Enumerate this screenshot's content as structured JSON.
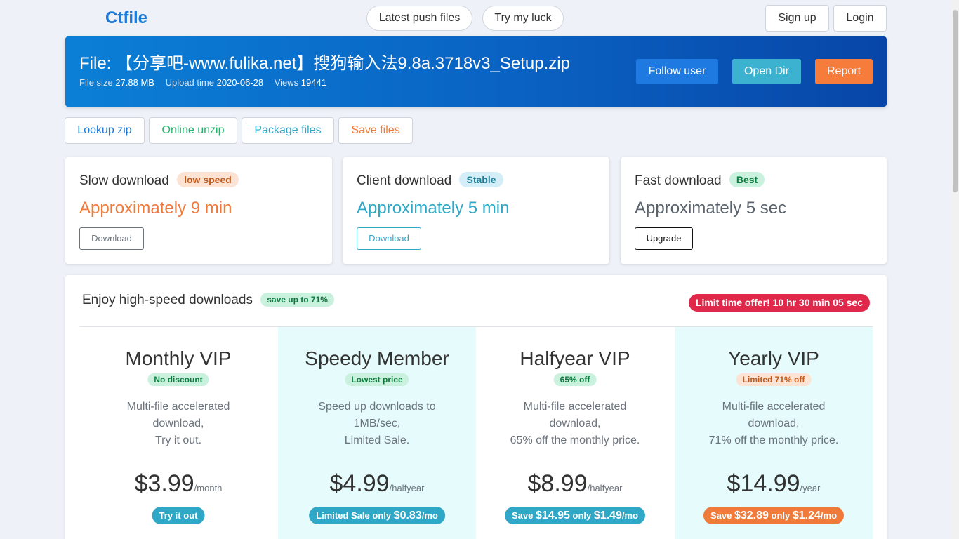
{
  "nav": {
    "brand": "Ctfile",
    "latest_push": "Latest push files",
    "try_luck": "Try my luck",
    "sign_up": "Sign up",
    "login": "Login"
  },
  "file": {
    "title": "File: 【分享吧-www.fulika.net】搜狗输入法9.8a.3718v3_Setup.zip",
    "size_label": "File size",
    "size": "27.88 MB",
    "upload_label": "Upload time",
    "upload": "2020-06-28",
    "views_label": "Views",
    "views": "19441",
    "follow": "Follow user",
    "open_dir": "Open Dir",
    "report": "Report"
  },
  "actions": {
    "lookup": "Lookup zip",
    "unzip": "Online unzip",
    "package": "Package files",
    "save": "Save files"
  },
  "downloads": {
    "slow": {
      "title": "Slow download",
      "badge": "low speed",
      "time": "Approximately 9 min",
      "button": "Download"
    },
    "client": {
      "title": "Client download",
      "badge": "Stable",
      "time": "Approximately 5 min",
      "button": "Download"
    },
    "fast": {
      "title": "Fast download",
      "badge": "Best",
      "time": "Approximately 5 sec",
      "button": "Upgrade"
    }
  },
  "pricing": {
    "title": "Enjoy high-speed downloads",
    "save_badge": "save up to 71%",
    "offer": "Limit time offer! 10 hr 30 min 05 sec",
    "plans": [
      {
        "name": "Monthly VIP",
        "tag": "No discount",
        "desc": [
          "Multi-file accelerated",
          "download,",
          "Try it out."
        ],
        "price": "$3.99",
        "period": "/month",
        "cta": {
          "prefix": "Try it out",
          "v1": "",
          "mid": "",
          "v2": "",
          "suffix": ""
        }
      },
      {
        "name": "Speedy Member",
        "tag": "Lowest price",
        "desc": [
          "Speed up downloads to",
          "1MB/sec,",
          "Limited Sale."
        ],
        "price": "$4.99",
        "period": "/halfyear",
        "cta": {
          "prefix": "Limited Sale only ",
          "v1": "$0.83",
          "mid": "",
          "v2": "",
          "suffix": "/mo"
        }
      },
      {
        "name": "Halfyear VIP",
        "tag": "65% off",
        "desc": [
          "Multi-file accelerated",
          "download,",
          "65% off the monthly price."
        ],
        "price": "$8.99",
        "period": "/halfyear",
        "cta": {
          "prefix": "Save ",
          "v1": "$14.95",
          "mid": " only ",
          "v2": "$1.49",
          "suffix": "/mo"
        }
      },
      {
        "name": "Yearly VIP",
        "tag": "Limited 71% off",
        "desc": [
          "Multi-file accelerated",
          "download,",
          "71% off the monthly price."
        ],
        "price": "$14.99",
        "period": "/year",
        "cta": {
          "prefix": "Save ",
          "v1": "$32.89",
          "mid": " only ",
          "v2": "$1.24",
          "suffix": "/mo"
        }
      }
    ]
  },
  "colors": {
    "brand": "#1e7ad8",
    "follow": "#1e7ae0",
    "open_dir": "#3db2d0",
    "report": "#f57c3a",
    "slow": "#f07a3a",
    "client": "#2fa8c8",
    "fast": "#5a636d",
    "green_badge": "#c9f1de",
    "offer": "#e0284a"
  }
}
